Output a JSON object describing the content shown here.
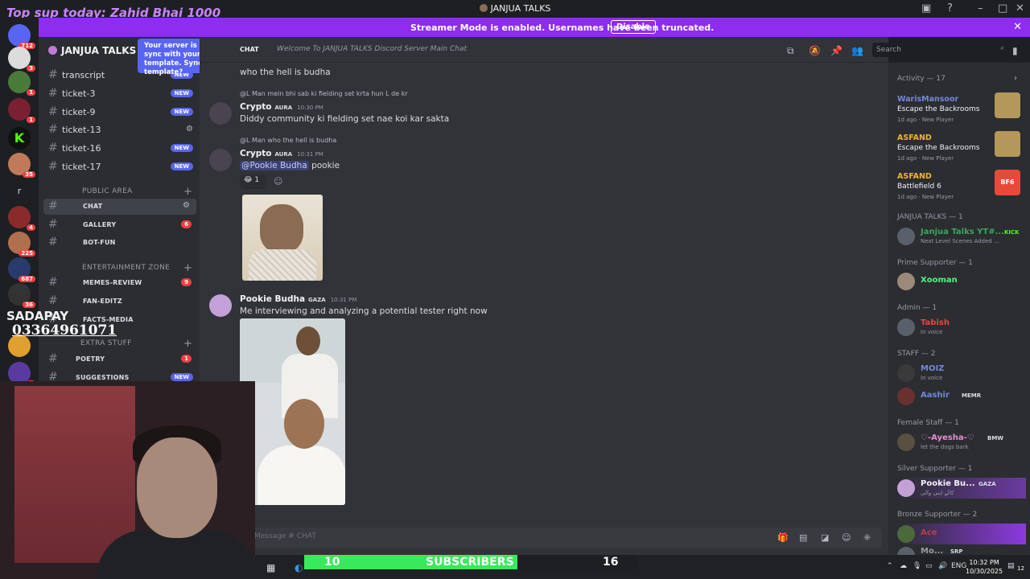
{
  "window": {
    "title": "JANJUA TALKS",
    "overlay_text": "Top sup today: Zahid Bhai 1000"
  },
  "streamer_banner": {
    "message": "Streamer Mode is enabled. Usernames have been truncated.",
    "button": "Disable",
    "close": "✕"
  },
  "server_rail": {
    "badges": [
      "712",
      "3",
      "1",
      "1",
      "35",
      "4",
      "225",
      "687",
      "36",
      "2"
    ],
    "letter": "r"
  },
  "sidebar": {
    "server_name": "JANJUA TALKS",
    "tooltip": "Your server is out of sync with your server template. Sync template?",
    "channels": [
      {
        "name": "transcript",
        "badge": "NEW"
      },
      {
        "name": "ticket-3",
        "badge": "NEW"
      },
      {
        "name": "ticket-9",
        "badge": "NEW"
      },
      {
        "name": "ticket-13",
        "badge": ""
      },
      {
        "name": "ticket-16",
        "badge": "NEW"
      },
      {
        "name": "ticket-17",
        "badge": "NEW"
      }
    ],
    "category_public": "PUBLIC AREA",
    "public_channels": [
      {
        "name": "CHAT",
        "badge": ""
      },
      {
        "name": "GALLERY",
        "badge": "6"
      },
      {
        "name": "BOT-FUN",
        "badge": ""
      }
    ],
    "category_entertainment": "ENTERTAINMENT ZONE",
    "ent_channels": [
      {
        "name": "MEMES-REVIEW",
        "badge": "9"
      },
      {
        "name": "FAN-EDITZ",
        "badge": ""
      },
      {
        "name": "FACTS-MEDIA",
        "badge": ""
      }
    ],
    "category_extra": "EXTRA STUFF",
    "extra_channels": [
      {
        "name": "POETRY",
        "badge": "1"
      },
      {
        "name": "SUGGESTIONS",
        "badge": "NEW"
      }
    ]
  },
  "header": {
    "channel": "CHAT",
    "topic": "Welcome To JANJUA TALKS Discord Server Main Chat",
    "search_placeholder": "Search"
  },
  "messages": {
    "m0_text": "who the hell is budha",
    "m1_reply": "@L Man mein bhi sab ki fielding set krta hun L de kr",
    "m1_author": "Crypto",
    "m1_tag": "AURA",
    "m1_time": "10:30 PM",
    "m1_text": "Diddy community ki fielding set nae koi kar sakta",
    "m2_reply": "@L Man who the hell is budha",
    "m2_author": "Crypto",
    "m2_tag": "AURA",
    "m2_time": "10:31 PM",
    "m2_mention": "@Pookie Budha",
    "m2_text": "pookie",
    "reaction_count": "1",
    "m3_author": "Pookie Budha",
    "m3_tag": "GAZA",
    "m3_time": "10:31 PM",
    "m3_text": "Me interviewing and analyzing a potential tester right now"
  },
  "composer": {
    "placeholder": "Message #",
    "channel": "CHAT"
  },
  "activity": {
    "header": "Activity — 17",
    "items": [
      {
        "user": "WarisMansoor",
        "game": "Escape the Backrooms",
        "meta": "1d ago · New Player",
        "color": "#5865f2",
        "thumb": ""
      },
      {
        "user": "ASFAND",
        "game": "Escape the Backrooms",
        "meta": "1d ago · New Player",
        "color": "#f0b232",
        "thumb": ""
      },
      {
        "user": "ASFAND",
        "game": "Battlefield 6",
        "meta": "1d ago · New Player",
        "color": "#f0b232",
        "thumb": "BF6"
      }
    ]
  },
  "members": {
    "groups": [
      {
        "header": "JANJUA TALKS — 1",
        "name": "Janjua Talks YT#...",
        "status": "Next Level Scenes Added ...",
        "color": "#3ba55d",
        "tag": "KICK"
      },
      {
        "header": "Prime Supporter — 1",
        "name": "Xooman",
        "status": "",
        "color": "#57f287",
        "tag": ""
      },
      {
        "header": "Admin — 1",
        "name": "Tabish",
        "status": "In voice",
        "color": "#ed4245",
        "tag": ""
      },
      {
        "header": "STAFF — 2",
        "name": "MOIZ",
        "status": "In voice",
        "color": "#7289da",
        "tag": ""
      },
      {
        "header": "",
        "name": "Aashir",
        "status": "",
        "color": "#7289da",
        "tag": "MEMR"
      },
      {
        "header": "Female Staff — 1",
        "name": "♡-Ayesha-♡",
        "status": "let the dogs bark",
        "color": "#e88bd8",
        "tag": "BMW"
      },
      {
        "header": "Silver Supporter — 1",
        "name": "Pookie Bu...",
        "status": "کالے اینی والی",
        "color": "#f2f3f5",
        "tag": "GAZA"
      },
      {
        "header": "Bronze Supporter — 2",
        "name": "Ace",
        "status": "",
        "color": "#ed4245",
        "tag": ""
      },
      {
        "header": "",
        "name": "Mo...",
        "status": "",
        "color": "#949ba4",
        "tag": "SRP"
      }
    ]
  },
  "stream_overlay": {
    "sadapay": "SADAPAY",
    "phone": "03364961071",
    "subs_current": "10",
    "subs_label": "SUBSCRIBERS",
    "subs_goal": "16",
    "subs_progress": 0.64,
    "subs_color": "#39e85b"
  },
  "taskbar": {
    "lang": "ENG",
    "time": "10:32 PM",
    "date": "10/30/2025",
    "notif": "12"
  }
}
